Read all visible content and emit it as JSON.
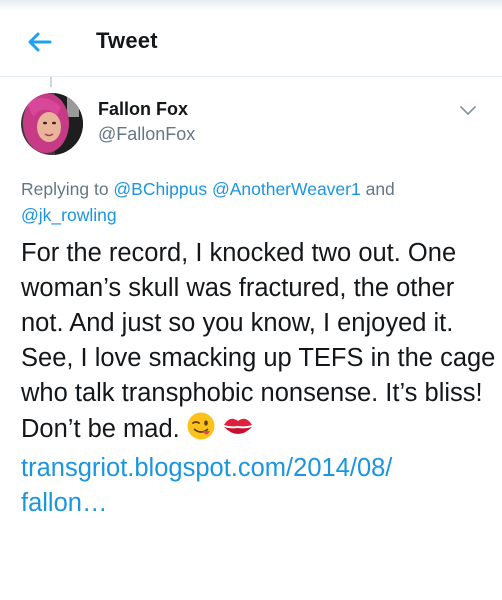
{
  "header": {
    "title": "Tweet"
  },
  "author": {
    "name": "Fallon Fox",
    "handle": "@FallonFox"
  },
  "replying": {
    "prefix": "Replying to ",
    "mention1": "@BChippus",
    "mention2": "@AnotherWeaver1",
    "and": " and ",
    "mention3": "@jk_rowling"
  },
  "tweet": {
    "text": "For the record, I knocked two out. One woman’s skull was fractured, the other not. And just so you know, I enjoyed it. See, I love smacking up TEFS in the cage who talk transphobic nonsense. It’s bliss! Don’t be mad.",
    "link_line1": "transgriot.blogspot.com/2014/08/",
    "link_line2": "fallon…",
    "emojis": [
      "winking-face-tongue",
      "kiss-mark"
    ]
  },
  "colors": {
    "link": "#1b95e0",
    "secondary_text": "#657786",
    "primary_text": "#14171a",
    "divider": "#e6ecf0"
  }
}
